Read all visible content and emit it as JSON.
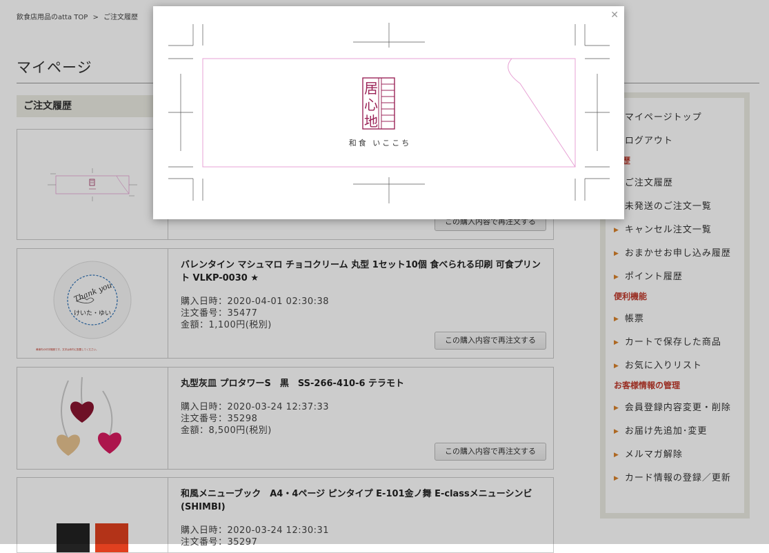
{
  "breadcrumb": {
    "home": "飲食店用品のatta TOP",
    "separator": ">",
    "current": "ご注文履歴"
  },
  "page_title": "マイページ",
  "section_title": "ご注文履歴",
  "reorder_label": "この購入内容で再注文する",
  "orders": [
    {
      "name": "",
      "date": "",
      "number": "",
      "amount": ""
    },
    {
      "name": "バレンタイン マシュマロ チョコクリーム 丸型 1セット10個 食べられる印刷 可食プリント VLKP-0030 ★",
      "date": "購入日時：2020-04-01 02:30:38",
      "number": "注文番号：35477",
      "amount": "金額：1,100円(税別)",
      "thumb_text": "Thank you",
      "thumb_sub": "けいた・ゆい",
      "thumb_note": "黄線内の印字範囲です。文字は枠内に配置してください。"
    },
    {
      "name": "丸型灰皿 プロタワーS　黒　SS-266-410-6 テラモト",
      "date": "購入日時：2020-03-24 12:37:33",
      "number": "注文番号：35298",
      "amount": "金額：8,500円(税別)"
    },
    {
      "name": "和風メニューブック　A4・4ページ ピンタイプ E-101金ノ舞 E-classメニューシンビ(SHIMBI)",
      "date": "購入日時：2020-03-24 12:30:31",
      "number": "注文番号：35297",
      "amount": ""
    }
  ],
  "sidebar": {
    "groups": [
      {
        "heading": "",
        "items": [
          "マイページトップ",
          "ログアウト"
        ]
      },
      {
        "heading": "履歴",
        "items": [
          "ご注文履歴",
          "未発送のご注文一覧",
          "キャンセル注文一覧",
          "おまかせお申し込み履歴",
          "ポイント履歴"
        ]
      },
      {
        "heading": "便利機能",
        "items": [
          "帳票",
          "カートで保存した商品",
          "お気に入りリスト"
        ]
      },
      {
        "heading": "お客様情報の管理",
        "items": [
          "会員登録内容変更・削除",
          "お届け先追加･変更",
          "メルマガ解除",
          "カード情報の登録／更新"
        ]
      }
    ]
  },
  "modal": {
    "close_icon": "close-icon",
    "seal_chars": [
      "居",
      "心",
      "地"
    ],
    "brand_text": "和食 いここち"
  },
  "colors": {
    "brand_magenta": "#9b2458",
    "trim_pink": "#e7a0d4",
    "accent_orange": "#d9822b",
    "heading_red": "#c0392b"
  }
}
